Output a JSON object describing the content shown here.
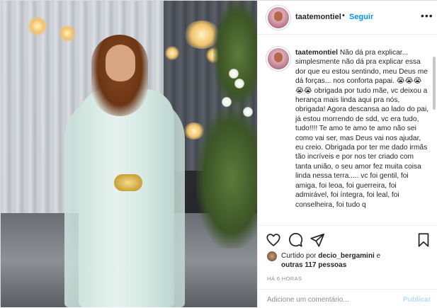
{
  "post": {
    "author": "taatemontiel",
    "separator": "•",
    "follow_label": "Seguir",
    "more_icon": "more-horizontal-icon",
    "caption_lead": "Não dá pra explicar... simplesmente não dá pra explicar essa dor que eu estou sentindo, meu Deus me dá forças... nos conforta papai.",
    "caption_emoji": "😭😭😭😭😭",
    "caption_body": " obrigada por tudo mãe, vc deixou a herança mais linda aqui pra nós, obrigada! Agora descansa ao lado do pai, já estou morrendo de sdd, vc era tudo, tudo!!!! Te amo te amo te amo não sei como vai ser, mas Deus vai nos ajudar, eu creio. Obrigada por ter me dado irmãs tão incríveis e por nos ter criado com tanta união, o seu amor fez muita coisa linda nessa terra..... vc foi gentil, foi amiga, foi leoa, foi guerreira, foi admirável, foi íntegra, foi leal, foi conselheira, foi tudo q",
    "likes_prefix": "Curtido por",
    "likes_user": "decio_bergamini",
    "likes_mid": " e",
    "likes_others": "outras 117 pessoas",
    "timestamp": "HÁ 6 HORAS",
    "comment_placeholder": "Adicione um comentário...",
    "publish_label": "Publicar"
  },
  "icons": [
    "heart-icon",
    "comment-icon",
    "share-icon",
    "bookmark-icon"
  ],
  "colors": {
    "accent": "#0095f6",
    "publish_disabled": "#b2dffc",
    "muted": "#8e8e8e",
    "text": "#262626",
    "border": "#efefef"
  }
}
